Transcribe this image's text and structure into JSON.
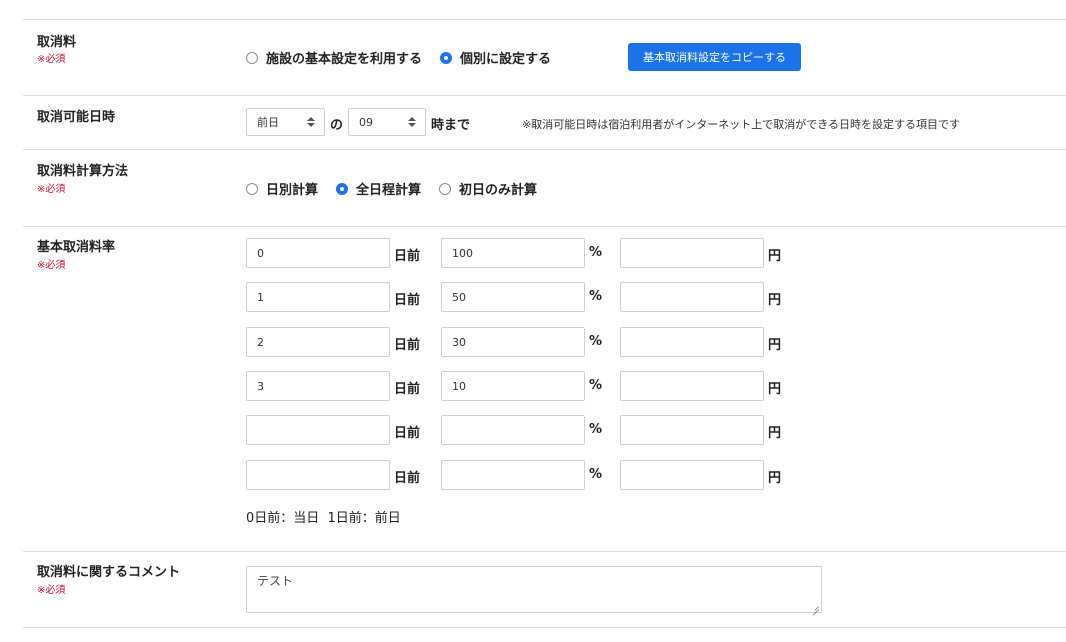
{
  "cancel_fee": {
    "label": "取消料",
    "required": "※必須",
    "options": [
      {
        "label": "施設の基本設定を利用する",
        "selected": false
      },
      {
        "label": "個別に設定する",
        "selected": true
      }
    ],
    "copy_button": "基本取消料設定をコピーする"
  },
  "cancel_deadline": {
    "label": "取消可能日時",
    "day_select": "前日",
    "connector": "の",
    "hour_select": "09",
    "suffix": "時まで",
    "note": "※取消可能日時は宿泊利用者がインターネット上で取消ができる日時を設定する項目です"
  },
  "calc_method": {
    "label": "取消料計算方法",
    "required": "※必須",
    "options": [
      {
        "label": "日別計算",
        "selected": false
      },
      {
        "label": "全日程計算",
        "selected": true
      },
      {
        "label": "初日のみ計算",
        "selected": false
      }
    ]
  },
  "rate": {
    "label": "基本取消料率",
    "required": "※必須",
    "units": {
      "days": "日前",
      "percent": "%",
      "yen": "円"
    },
    "rows": [
      {
        "days": "0",
        "percent": "100",
        "yen": ""
      },
      {
        "days": "1",
        "percent": "50",
        "yen": ""
      },
      {
        "days": "2",
        "percent": "30",
        "yen": ""
      },
      {
        "days": "3",
        "percent": "10",
        "yen": ""
      },
      {
        "days": "",
        "percent": "",
        "yen": ""
      },
      {
        "days": "",
        "percent": "",
        "yen": ""
      }
    ],
    "legend": "0日前：当日  1日前：前日"
  },
  "comment": {
    "label": "取消料に関するコメント",
    "required": "※必須",
    "value": "テスト"
  }
}
